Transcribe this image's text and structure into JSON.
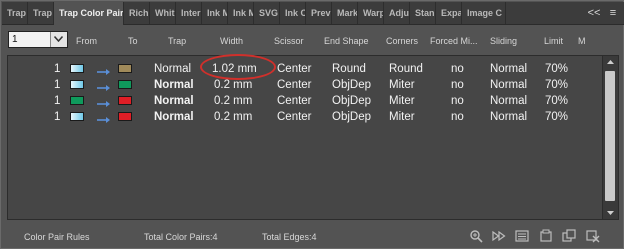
{
  "tabs": [
    {
      "label": "Trap",
      "active": false
    },
    {
      "label": "Trap",
      "active": false
    },
    {
      "label": "Trap Color Pairs",
      "active": true
    },
    {
      "label": "Rich",
      "active": false
    },
    {
      "label": "Whit",
      "active": false
    },
    {
      "label": "Inter",
      "active": false
    },
    {
      "label": "Ink M",
      "active": false
    },
    {
      "label": "Ink M",
      "active": false
    },
    {
      "label": "SVG",
      "active": false
    },
    {
      "label": "Ink C",
      "active": false
    },
    {
      "label": "Previ",
      "active": false
    },
    {
      "label": "Mark",
      "active": false
    },
    {
      "label": "Warp",
      "active": false
    },
    {
      "label": "Adju",
      "active": false
    },
    {
      "label": "Stan",
      "active": false
    },
    {
      "label": "Expa",
      "active": false
    },
    {
      "label": "Image C",
      "active": false
    }
  ],
  "tab_controls": {
    "collapse": "<<",
    "menu": "≡"
  },
  "filter_select": {
    "value": "1"
  },
  "columns": {
    "from": "From",
    "to": "To",
    "trap": "Trap",
    "width": "Width",
    "scissor": "Scissor",
    "end_shape": "End Shape",
    "corners": "Corners",
    "forced": "Forced Mi...",
    "sliding": "Sliding",
    "limit": "Limit",
    "m": "M"
  },
  "rows": [
    {
      "num": "1",
      "from_color": "#6fc8e8",
      "to_color": "#a08a5a",
      "trap": "Normal",
      "trap_bold": false,
      "width": "1.02 mm",
      "scissor": "Center",
      "end_shape": "Round",
      "corners": "Round",
      "forced": "no",
      "sliding": "Normal",
      "limit": "70%"
    },
    {
      "num": "1",
      "from_color": "#6fc8e8",
      "to_color": "#0f9a5c",
      "trap": "Normal",
      "trap_bold": true,
      "width": "0.2 mm",
      "scissor": "Center",
      "end_shape": "ObjDep",
      "corners": "Miter",
      "forced": "no",
      "sliding": "Normal",
      "limit": "70%"
    },
    {
      "num": "1",
      "from_color": "#0f9a5c",
      "to_color": "#e01e26",
      "trap": "Normal",
      "trap_bold": true,
      "width": "0.2 mm",
      "scissor": "Center",
      "end_shape": "ObjDep",
      "corners": "Miter",
      "forced": "no",
      "sliding": "Normal",
      "limit": "70%"
    },
    {
      "num": "1",
      "from_color": "#6fc8e8",
      "to_color": "#e01e26",
      "trap": "Normal",
      "trap_bold": true,
      "width": "0.2 mm",
      "scissor": "Center",
      "end_shape": "ObjDep",
      "corners": "Miter",
      "forced": "no",
      "sliding": "Normal",
      "limit": "70%"
    }
  ],
  "footer": {
    "rules": "Color Pair Rules",
    "total_pairs": "Total Color Pairs:4",
    "total_edges": "Total Edges:4"
  },
  "footer_icons": [
    "zoom-icon",
    "play-forward-icon",
    "list-view-icon",
    "new-icon",
    "duplicate-icon",
    "delete-icon"
  ],
  "colors": {
    "highlight": "#d0302b",
    "panel": "#535353",
    "list_bg": "#464646"
  }
}
